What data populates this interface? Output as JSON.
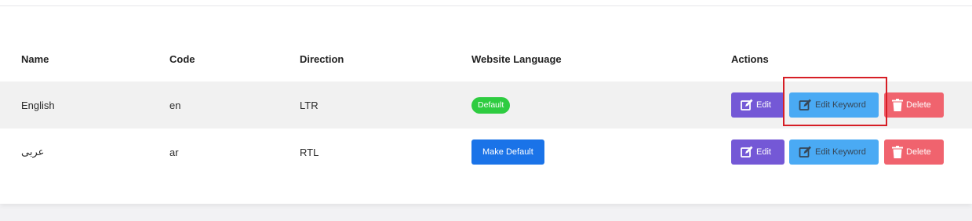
{
  "table": {
    "headers": {
      "name": "Name",
      "code": "Code",
      "direction": "Direction",
      "website_language": "Website Language",
      "actions": "Actions"
    },
    "rows": [
      {
        "name": "English",
        "code": "en",
        "direction": "LTR",
        "website_language": "Default",
        "edit": "Edit",
        "edit_keyword": "Edit Keyword",
        "delete": "Delete"
      },
      {
        "name": "عربى",
        "code": "ar",
        "direction": "RTL",
        "website_language": "Make Default",
        "edit": "Edit",
        "edit_keyword": "Edit Keyword",
        "delete": "Delete"
      }
    ]
  },
  "colors": {
    "edit_button": "#7458d6",
    "edit_keyword_button": "#4aaaf4",
    "delete_button": "#f0636e",
    "default_badge": "#2ecc40",
    "make_default_button": "#1a73e8",
    "highlight_box": "#d61e25"
  },
  "icons": {
    "edit": "edit-icon",
    "edit_keyword": "edit-icon",
    "delete": "trash-icon"
  }
}
